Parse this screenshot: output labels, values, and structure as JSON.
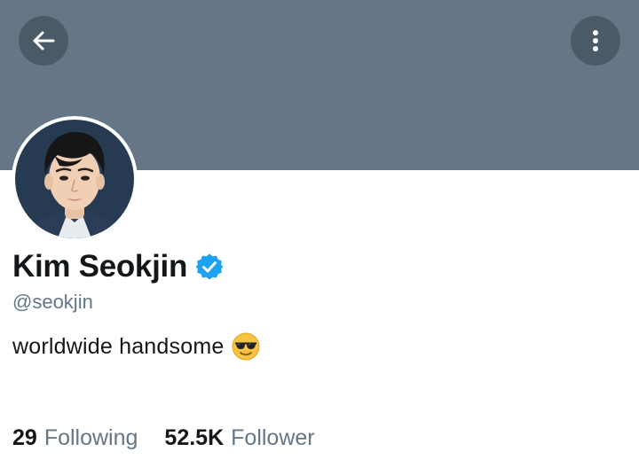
{
  "header": {
    "back_icon": "arrow-left-icon",
    "more_icon": "vertical-dots-icon",
    "banner_color": "#657786",
    "button_color": "#4b5a67"
  },
  "profile": {
    "display_name": "Kim Seokjin",
    "verified_icon": "verified-badge-icon",
    "verified_color": "#1da1f2",
    "handle": "@seokjin",
    "bio": "worldwide handsome",
    "bio_emoji": "smiling-face-with-sunglasses-icon"
  },
  "stats": {
    "following_count": "29",
    "following_label": "Following",
    "followers_count": "52.5K",
    "followers_label": "Follower"
  }
}
